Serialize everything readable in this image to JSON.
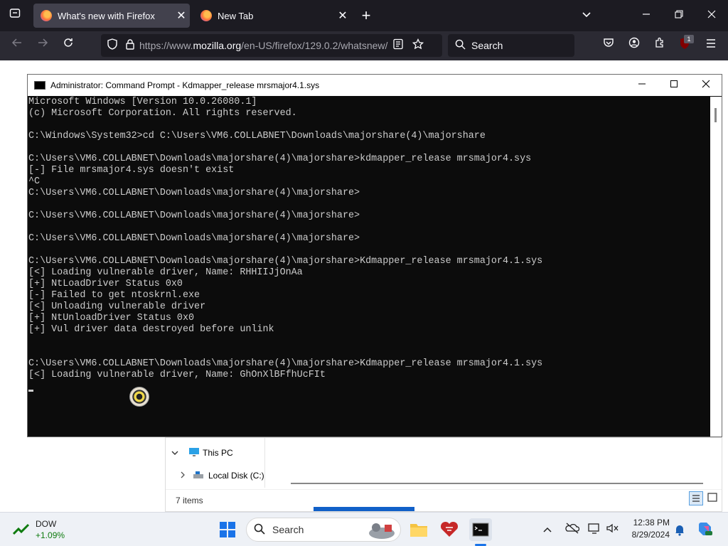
{
  "browser": {
    "tabs": [
      {
        "label": "What's new with Firefox",
        "active": true
      },
      {
        "label": "New Tab",
        "active": false
      }
    ],
    "url_prefix": "https://www.",
    "url_domain": "mozilla.org",
    "url_rest": "/en-US/firefox/129.0.2/whatsnew/",
    "search_placeholder": "Search",
    "extension_badge": "1"
  },
  "cmd_window": {
    "title": "Administrator: Command Prompt - Kdmapper_release  mrsmajor4.1.sys",
    "lines": [
      "Microsoft Windows [Version 10.0.26080.1]",
      "(c) Microsoft Corporation. All rights reserved.",
      "",
      "C:\\Windows\\System32>cd C:\\Users\\VM6.COLLABNET\\Downloads\\majorshare(4)\\majorshare",
      "",
      "C:\\Users\\VM6.COLLABNET\\Downloads\\majorshare(4)\\majorshare>kdmapper_release mrsmajor4.sys",
      "[-] File mrsmajor4.sys doesn't exist",
      "^C",
      "C:\\Users\\VM6.COLLABNET\\Downloads\\majorshare(4)\\majorshare>",
      "",
      "C:\\Users\\VM6.COLLABNET\\Downloads\\majorshare(4)\\majorshare>",
      "",
      "C:\\Users\\VM6.COLLABNET\\Downloads\\majorshare(4)\\majorshare>",
      "",
      "C:\\Users\\VM6.COLLABNET\\Downloads\\majorshare(4)\\majorshare>Kdmapper_release mrsmajor4.1.sys",
      "[<] Loading vulnerable driver, Name: RHHIIJjOnAa",
      "[+] NtLoadDriver Status 0x0",
      "[-] Failed to get ntoskrnl.exe",
      "[<] Unloading vulnerable driver",
      "[+] NtUnloadDriver Status 0x0",
      "[+] Vul driver data destroyed before unlink",
      "",
      "",
      "C:\\Users\\VM6.COLLABNET\\Downloads\\majorshare(4)\\majorshare>Kdmapper_release mrsmajor4.1.sys",
      "[<] Loading vulnerable driver, Name: GhOnXlBFfhUcFIt"
    ]
  },
  "explorer": {
    "nav_items": [
      "This PC",
      "Local Disk (C:)"
    ],
    "status": "7 items"
  },
  "taskbar": {
    "stock_name": "DOW",
    "stock_change": "+1.09%",
    "search_label": "Search",
    "time": "12:38 PM",
    "date": "8/29/2024"
  },
  "colors": {
    "browser_dark": "#1c1b22",
    "console_bg": "#0c0c0c",
    "console_text": "#cccccc",
    "stock_up": "#0f7b0f"
  }
}
